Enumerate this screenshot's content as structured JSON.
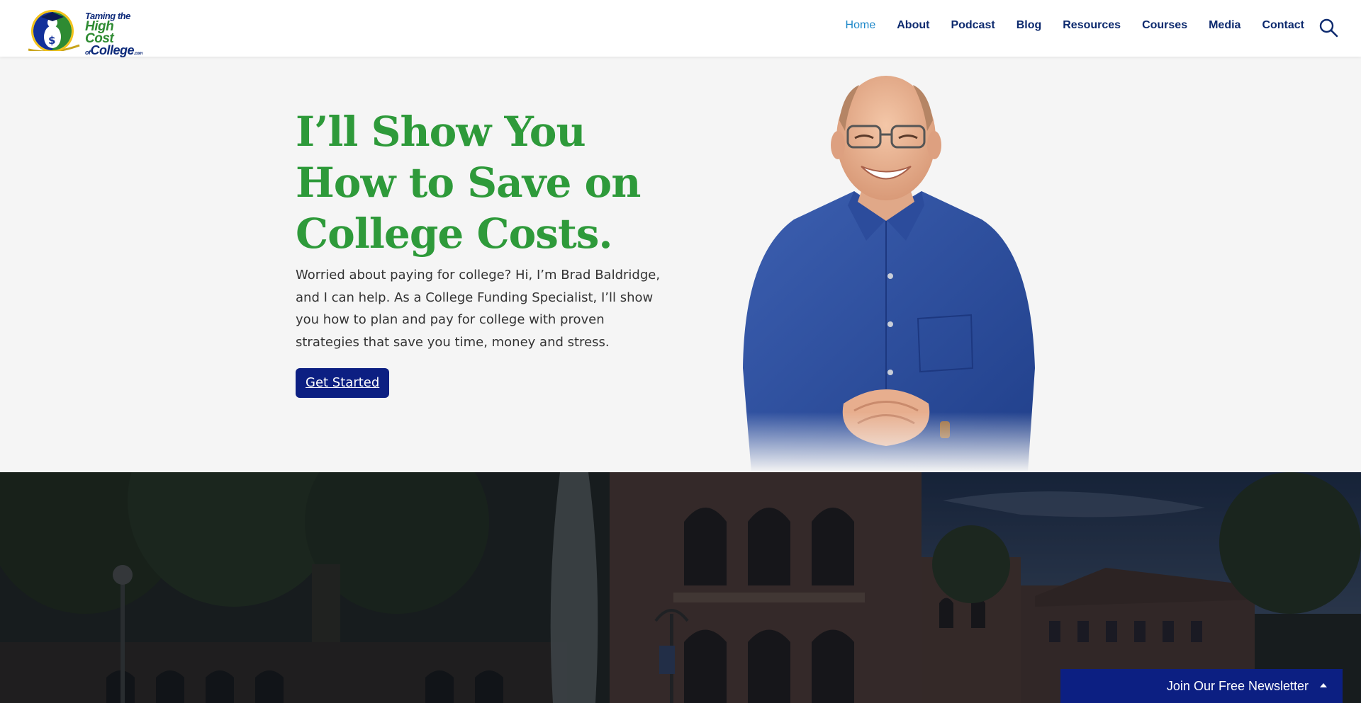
{
  "header": {
    "logo": {
      "line1": "Taming the",
      "line2": "High Cost",
      "of": "of",
      "line3": "College",
      "com": ".com",
      "icon": "graduate-dollar-emblem-icon"
    },
    "nav": [
      {
        "label": "Home",
        "active": true
      },
      {
        "label": "About"
      },
      {
        "label": "Podcast"
      },
      {
        "label": "Blog"
      },
      {
        "label": "Resources"
      },
      {
        "label": "Courses"
      },
      {
        "label": "Media"
      },
      {
        "label": "Contact"
      }
    ],
    "search_icon": "search-icon"
  },
  "hero": {
    "title": "I’ll Show You How to Save on College Costs.",
    "description": "Worried about paying for college? Hi, I’m Brad Baldridge, and I can help. As a College Funding Specialist, I’ll show you how to plan and pay for college with proven strategies that save you time, money and stress.",
    "cta_label": "Get Started"
  },
  "newsletter": {
    "label": "Join Our Free Newsletter",
    "icon": "chevron-up-icon"
  },
  "colors": {
    "nav_active": "#1e88c9",
    "nav": "#0d2a6e",
    "title_green": "#2e9a3a",
    "brand_blue": "#0c1f82",
    "hero_bg": "#f5f5f5"
  }
}
